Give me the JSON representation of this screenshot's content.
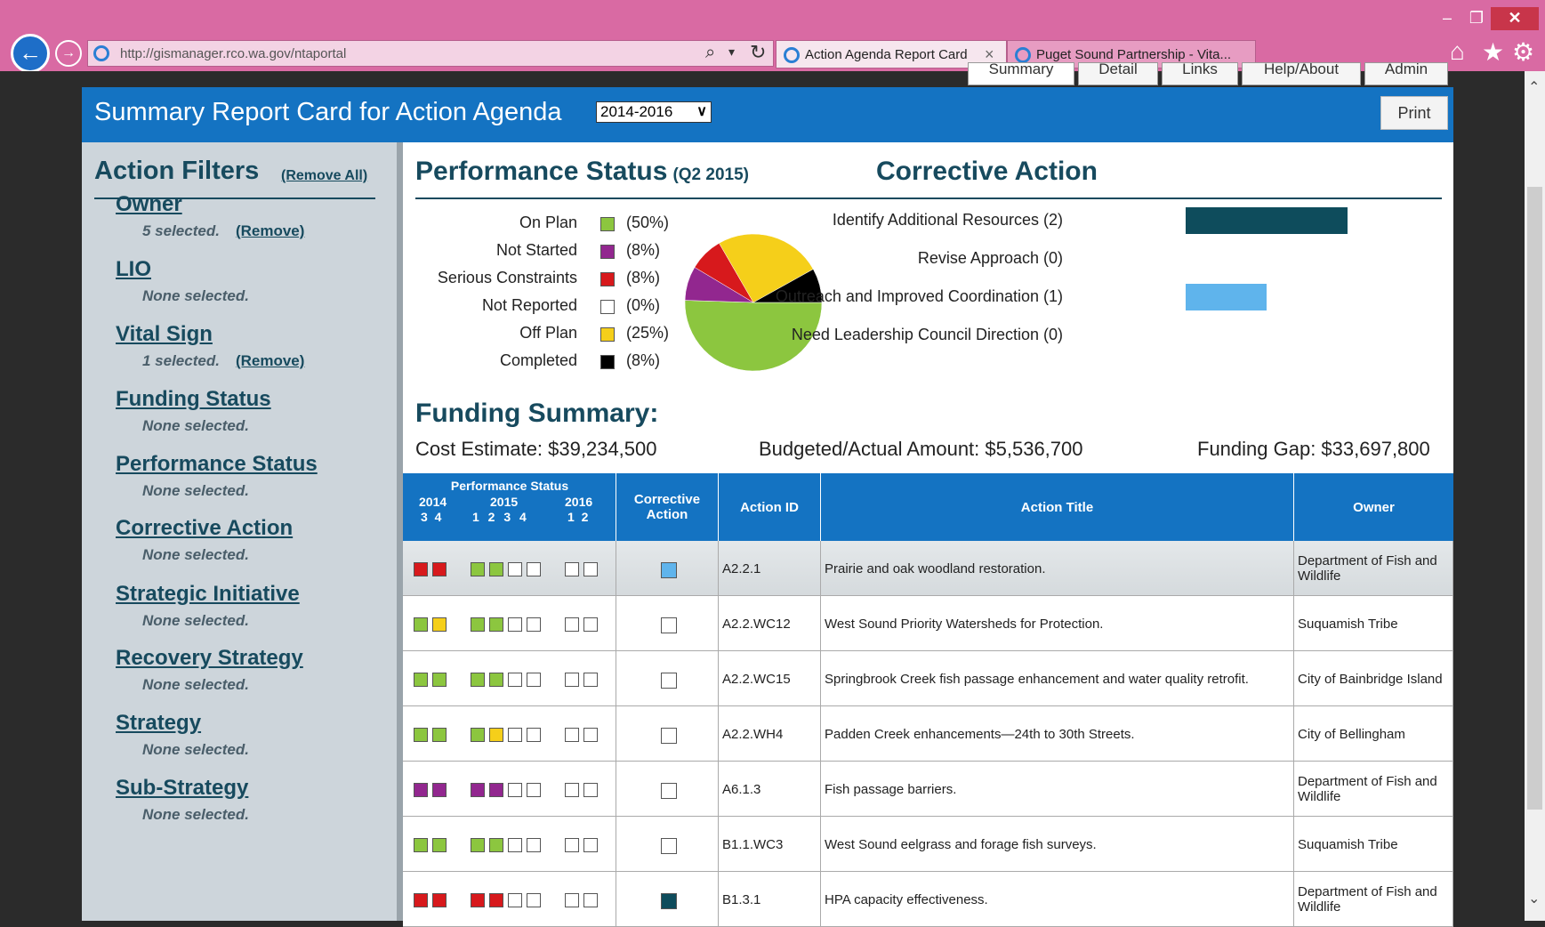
{
  "browser": {
    "url": "http://gismanager.rco.wa.gov/ntaportal",
    "tabs": [
      {
        "label": "Action Agenda Report Card",
        "close": "×"
      },
      {
        "label": "Puget Sound Partnership - Vita..."
      }
    ],
    "window": {
      "minimize": "–",
      "maximize": "❐",
      "close": "✕"
    },
    "icons": {
      "back": "←",
      "forward": "→",
      "search": "⌕",
      "dropdown": "▾",
      "refresh": "↻",
      "home": "⌂",
      "favorites": "★",
      "settings": "⚙"
    }
  },
  "nav_tabs": [
    "Summary",
    "Detail",
    "Links",
    "Help/About",
    "Admin"
  ],
  "header": {
    "title": "Summary Report Card for Action Agenda",
    "period": "2014-2016",
    "print_label": "Print"
  },
  "sidebar": {
    "title": "Action Filters",
    "remove_all": "(Remove All)",
    "filters": [
      {
        "name": "Owner",
        "status": "5 selected.",
        "remove": "(Remove)"
      },
      {
        "name": "LIO",
        "status": "None selected."
      },
      {
        "name": "Vital Sign",
        "status": "1 selected.",
        "remove": "(Remove)"
      },
      {
        "name": "Funding Status",
        "status": "None selected."
      },
      {
        "name": "Performance Status",
        "status": "None selected."
      },
      {
        "name": "Corrective Action",
        "status": "None selected."
      },
      {
        "name": "Strategic Initiative",
        "status": "None selected."
      },
      {
        "name": "Recovery Strategy",
        "status": "None selected."
      },
      {
        "name": "Strategy",
        "status": "None selected."
      },
      {
        "name": "Sub-Strategy",
        "status": "None selected."
      }
    ]
  },
  "performance": {
    "title": "Performance Status",
    "quarter": "(Q2 2015)",
    "legend": [
      {
        "label": "On Plan",
        "pct": "(50%)",
        "color": "#8cc63f"
      },
      {
        "label": "Not Started",
        "pct": "(8%)",
        "color": "#92278f"
      },
      {
        "label": "Serious Constraints",
        "pct": "(8%)",
        "color": "#d7191c"
      },
      {
        "label": "Not Reported",
        "pct": "(0%)",
        "color": "#ffffff"
      },
      {
        "label": "Off Plan",
        "pct": "(25%)",
        "color": "#f5cf1a"
      },
      {
        "label": "Completed",
        "pct": "(8%)",
        "color": "#000000"
      }
    ]
  },
  "chart_data": [
    {
      "type": "pie",
      "title": "Performance Status",
      "categories": [
        "On Plan",
        "Not Started",
        "Serious Constraints",
        "Not Reported",
        "Off Plan",
        "Completed"
      ],
      "values": [
        50,
        8,
        8,
        0,
        25,
        8
      ]
    },
    {
      "type": "bar",
      "title": "Corrective Action",
      "categories": [
        "Identify Additional Resources",
        "Revise Approach",
        "Outreach and Improved Coordination",
        "Need Leadership Council Direction"
      ],
      "values": [
        2,
        0,
        1,
        0
      ],
      "colors": [
        "#0e4c5c",
        "#0e4c5c",
        "#5fb4ec",
        "#0e4c5c"
      ]
    }
  ],
  "corrective": {
    "title": "Corrective Action",
    "items": [
      {
        "label": "Identify Additional Resources (2)",
        "count": 2
      },
      {
        "label": "Revise Approach (0)",
        "count": 0
      },
      {
        "label": "Outreach and Improved Coordination (1)",
        "count": 1
      },
      {
        "label": "Need Leadership Council Direction (0)",
        "count": 0
      }
    ]
  },
  "funding": {
    "title": "Funding Summary:",
    "cost": "Cost Estimate: $39,234,500",
    "budget": "Budgeted/Actual Amount: $5,536,700",
    "gap": "Funding Gap: $33,697,800"
  },
  "table": {
    "headers": {
      "perf": "Performance Status",
      "years": [
        "2014",
        "2015",
        "2016"
      ],
      "quarters": [
        "3 4",
        "1 2 3 4",
        "1 2"
      ],
      "corrective": "Corrective Action",
      "action_id": "Action ID",
      "action_title": "Action Title",
      "owner": "Owner"
    },
    "status_colors": {
      "G": "#8cc63f",
      "Y": "#f5cf1a",
      "R": "#d7191c",
      "P": "#92278f",
      "W": "#ffffff"
    },
    "corr_colors": {
      "none": "#ffffff",
      "outreach": "#5fb4ec",
      "resources": "#0e4c5c"
    },
    "rows": [
      {
        "status": [
          "R",
          "R",
          "G",
          "G",
          "W",
          "W",
          "W",
          "W"
        ],
        "corrective": "outreach",
        "id": "A2.2.1",
        "title": "Prairie and oak woodland restoration.",
        "owner": "Department of Fish and Wildlife",
        "selected": true
      },
      {
        "status": [
          "G",
          "Y",
          "G",
          "G",
          "W",
          "W",
          "W",
          "W"
        ],
        "corrective": "none",
        "id": "A2.2.WC12",
        "title": "West Sound Priority Watersheds for Protection.",
        "owner": "Suquamish Tribe"
      },
      {
        "status": [
          "G",
          "G",
          "G",
          "G",
          "W",
          "W",
          "W",
          "W"
        ],
        "corrective": "none",
        "id": "A2.2.WC15",
        "title": "Springbrook Creek fish passage enhancement and water quality retrofit.",
        "owner": "City of Bainbridge Island"
      },
      {
        "status": [
          "G",
          "G",
          "G",
          "Y",
          "W",
          "W",
          "W",
          "W"
        ],
        "corrective": "none",
        "id": "A2.2.WH4",
        "title": "Padden Creek enhancements—24th to 30th Streets.",
        "owner": "City of Bellingham"
      },
      {
        "status": [
          "P",
          "P",
          "P",
          "P",
          "W",
          "W",
          "W",
          "W"
        ],
        "corrective": "none",
        "id": "A6.1.3",
        "title": "Fish passage barriers.",
        "owner": "Department of Fish and Wildlife"
      },
      {
        "status": [
          "G",
          "G",
          "G",
          "G",
          "W",
          "W",
          "W",
          "W"
        ],
        "corrective": "none",
        "id": "B1.1.WC3",
        "title": "West Sound eelgrass and forage fish surveys.",
        "owner": "Suquamish Tribe"
      },
      {
        "status": [
          "R",
          "R",
          "R",
          "R",
          "W",
          "W",
          "W",
          "W"
        ],
        "corrective": "resources",
        "id": "B1.3.1",
        "title": "HPA capacity effectiveness.",
        "owner": "Department of Fish and Wildlife"
      }
    ]
  }
}
